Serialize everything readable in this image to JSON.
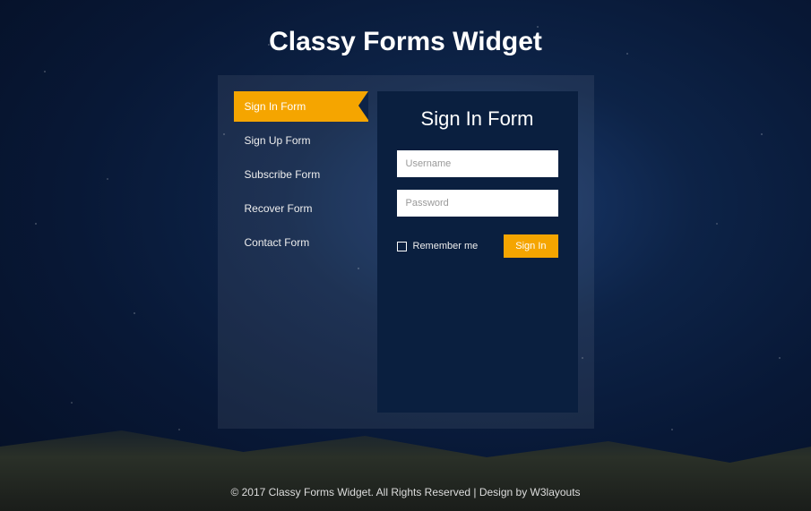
{
  "header": {
    "title": "Classy Forms Widget"
  },
  "sidebar": {
    "items": [
      {
        "label": "Sign In Form",
        "active": true
      },
      {
        "label": "Sign Up Form",
        "active": false
      },
      {
        "label": "Subscribe Form",
        "active": false
      },
      {
        "label": "Recover Form",
        "active": false
      },
      {
        "label": "Contact Form",
        "active": false
      }
    ]
  },
  "form": {
    "title": "Sign In Form",
    "username_placeholder": "Username",
    "password_placeholder": "Password",
    "remember_label": "Remember me",
    "remember_checked": false,
    "submit_label": "Sign In"
  },
  "footer": {
    "copyright": "© 2017 Classy Forms Widget. All Rights Reserved | Design by ",
    "link_text": "W3layouts"
  },
  "colors": {
    "accent": "#f5a500",
    "panel": "#0a1f3f"
  }
}
